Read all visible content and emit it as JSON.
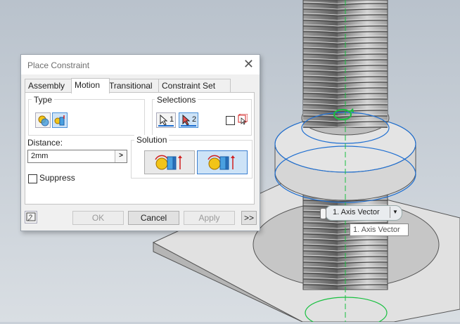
{
  "dialog": {
    "title": "Place Constraint",
    "tabs": [
      "Assembly",
      "Motion",
      "Transitional",
      "Constraint Set"
    ],
    "active_tab": "Motion",
    "type_label": "Type",
    "selections_label": "Selections",
    "selection_1": "1",
    "selection_2": "2",
    "distance_label": "Distance:",
    "distance_value": "2mm",
    "solution_label": "Solution",
    "suppress_label": "Suppress",
    "buttons": {
      "ok": "OK",
      "cancel": "Cancel",
      "apply": "Apply",
      "more": ">>"
    }
  },
  "viewport": {
    "chip_label": "1. Axis Vector",
    "tooltip": "1. Axis Vector"
  },
  "colors": {
    "accent": "#1f6fd1",
    "highlight_green": "#18c040"
  }
}
